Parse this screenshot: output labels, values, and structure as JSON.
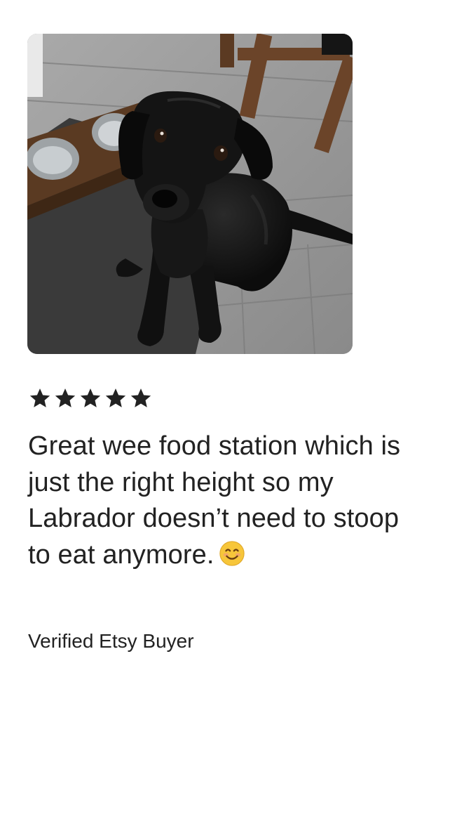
{
  "review": {
    "photo_subject": "black-labrador-photo",
    "rating": 5,
    "rating_max": 5,
    "text": "Great wee food station which is just the right height so my Labrador doesn’t need to stoop to eat anymore.",
    "emoji": "smiling-face-emoji",
    "author": "Verified Etsy Buyer"
  },
  "colors": {
    "text": "#222222",
    "star": "#222222",
    "background": "#ffffff"
  }
}
